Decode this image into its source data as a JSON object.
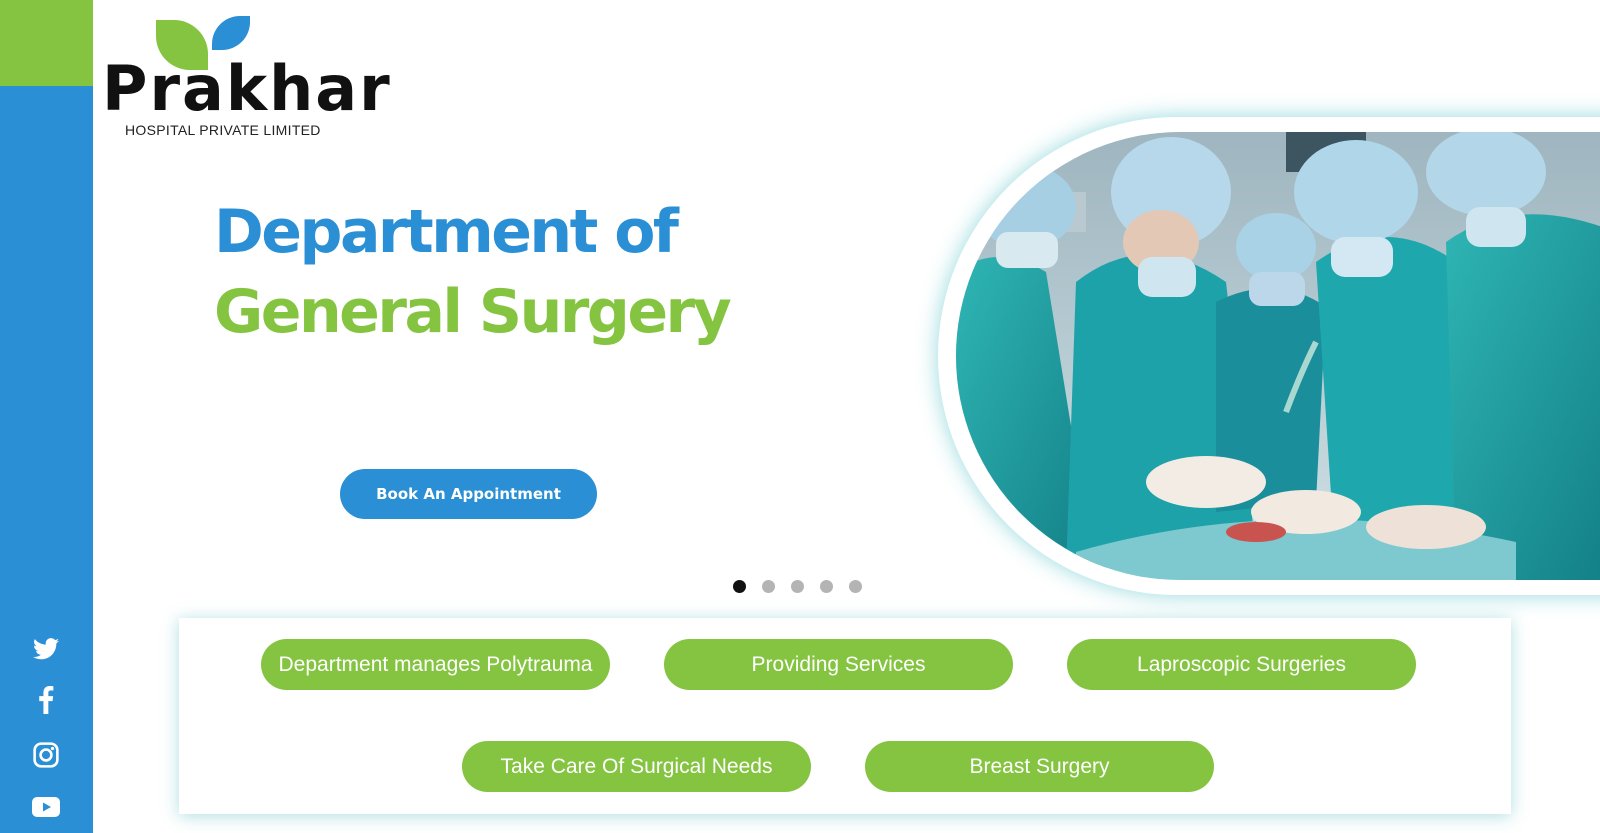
{
  "brand": {
    "name": "Prakhar",
    "subtitle": "HOSPITAL PRIVATE LIMITED",
    "colors": {
      "blue": "#2a8fd4",
      "green": "#84c441"
    }
  },
  "hero": {
    "title_line1": "Department of",
    "title_line2": "General Surgery",
    "cta_label": "Book An Appointment"
  },
  "carousel": {
    "slide_count": 5,
    "active_index": 0
  },
  "social": [
    "twitter-icon",
    "facebook-icon",
    "instagram-icon",
    "youtube-icon"
  ],
  "services": [
    "Department manages Polytrauma",
    "Providing Services",
    "Laproscopic Surgeries",
    "Take Care Of Surgical Needs",
    "Breast Surgery"
  ]
}
